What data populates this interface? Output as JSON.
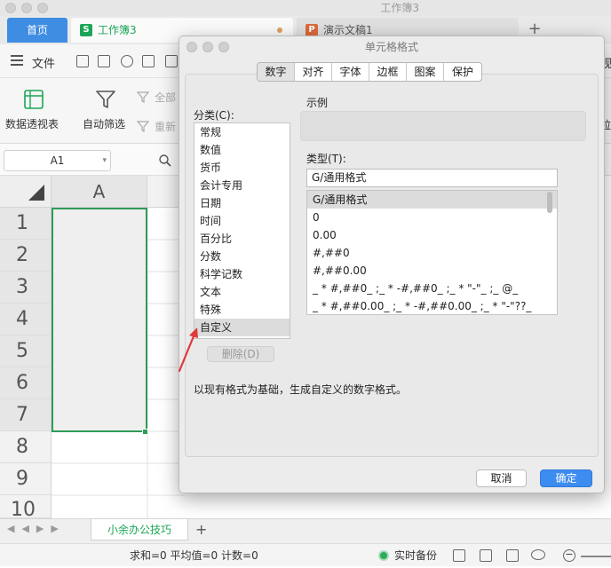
{
  "window": {
    "title": "工作簿3"
  },
  "tabs": {
    "home": "首页",
    "workbook": {
      "icon": "S",
      "label": "工作簿3"
    },
    "presentation": {
      "icon": "P",
      "label": "演示文稿1"
    },
    "add": "+"
  },
  "menu": {
    "file": "文件",
    "view_partial": "视"
  },
  "ribbon": {
    "pivot": "数据透视表",
    "autofilter": "自动筛选",
    "all_partial": "全部",
    "reapply_partial": "重新",
    "right_partial": "拉"
  },
  "formula_bar": {
    "name_box": "A1"
  },
  "grid": {
    "column_headers": [
      "A"
    ],
    "row_headers": [
      "1",
      "2",
      "3",
      "4",
      "5",
      "6",
      "7",
      "8",
      "9",
      "10"
    ]
  },
  "sheet_tabs": {
    "active": "小余办公技巧",
    "add": "+"
  },
  "status_bar": {
    "summary": "求和=0  平均值=0  计数=0",
    "backup": "实时备份"
  },
  "dialog": {
    "title": "单元格格式",
    "tabs": [
      "数字",
      "对齐",
      "字体",
      "边框",
      "图案",
      "保护"
    ],
    "active_tab": "数字",
    "category_label": "分类(C):",
    "categories": [
      "常规",
      "数值",
      "货币",
      "会计专用",
      "日期",
      "时间",
      "百分比",
      "分数",
      "科学记数",
      "文本",
      "特殊",
      "自定义"
    ],
    "selected_category": "自定义",
    "delete_button": "删除(D)",
    "sample_label": "示例",
    "type_label": "类型(T):",
    "type_value": "G/通用格式",
    "formats": [
      "G/通用格式",
      "0",
      "0.00",
      "#,##0",
      "#,##0.00",
      "_ * #,##0_ ;_ * -#,##0_ ;_ * \"-\"_ ;_ @_",
      "_ * #,##0.00_ ;_ * -#,##0.00_ ;_ * \"-\"??_"
    ],
    "selected_format": "G/通用格式",
    "description": "以现有格式为基础，生成自定义的数字格式。",
    "cancel_button": "取消",
    "ok_button": "确定"
  },
  "colors": {
    "accent_blue": "#3f8de3",
    "sheet_green": "#1ca556",
    "selection_green": "#2e9b58",
    "ok_button": "#3d8cf0",
    "annotation_arrow": "#e03a3a"
  }
}
